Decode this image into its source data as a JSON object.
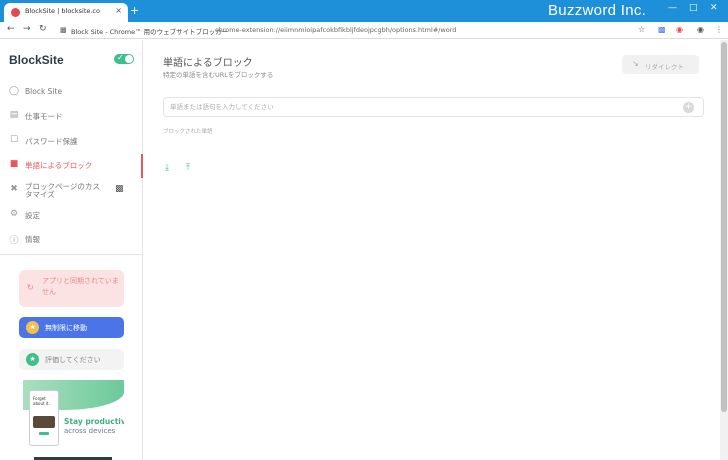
{
  "browser": {
    "tab_title": "BlockSite | blocksite.co",
    "tab_close": "×",
    "new_tab": "+",
    "brand_overlay": "Buzzword Inc.",
    "omnibox_title": "Block Site - Chrome™ 用のウェブサイトブロッカー",
    "omnibox_url": "chrome-extension://eiimnmioipafcokbfikbljfdeojpcgbh/options.html#/word"
  },
  "sidebar": {
    "logo": "BlockSite",
    "items": [
      {
        "label": "Block Site",
        "icon": "shield-icon"
      },
      {
        "label": "仕事モード",
        "icon": "briefcase-icon"
      },
      {
        "label": "パスワード保護",
        "icon": "lock-icon"
      },
      {
        "label": "単語によるブロック",
        "icon": "chat-icon"
      },
      {
        "label": "ブロックページのカスタマイズ",
        "icon": "tools-icon"
      },
      {
        "label": "設定",
        "icon": "gear-icon"
      },
      {
        "label": "情報",
        "icon": "info-icon"
      }
    ],
    "not_synced": "アプリと同期されていません",
    "unlimited": "無制限に移動",
    "rate": "評価してください",
    "promo_phone_text": "Forget about it.",
    "promo_title": "Stay productive",
    "promo_subtitle": "across devices"
  },
  "main": {
    "title": "単語によるブロック",
    "subtitle": "特定の単語を含むURLをブロックする",
    "redirect_label": "リダイレクト",
    "input_placeholder": "単語または語句を入力してください",
    "blocked_words_label": "ブロックされた単語"
  },
  "colors": {
    "accent": "#e8585b",
    "green": "#3fbf8f",
    "blue": "#4a74e8",
    "chrome": "#1e8fd9"
  }
}
